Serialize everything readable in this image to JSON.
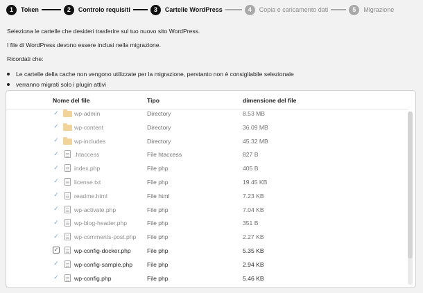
{
  "stepper": {
    "steps": [
      {
        "num": "1",
        "label": "Token",
        "state": "done"
      },
      {
        "num": "2",
        "label": "Controlo requisiti",
        "state": "done"
      },
      {
        "num": "3",
        "label": "Cartelle WordPress",
        "state": "active"
      },
      {
        "num": "4",
        "label": "Copia e caricamento dati",
        "state": "todo"
      },
      {
        "num": "5",
        "label": "Migrazione",
        "state": "todo"
      }
    ]
  },
  "intro": {
    "line1": "Seleziona le cartelle che desideri trasferire sul tuo nuovo sito WordPress.",
    "line2": "I file di WordPress devono essere inclusi nella migrazione.",
    "line3": "Ricordati che:",
    "bullets": [
      "Le cartelle della cache non vengono utilizzate per la migrazione, perstanto non è consigliabile selezionale",
      "verranno migrati solo i plugin attivi"
    ]
  },
  "table": {
    "headers": {
      "name": "Nome del file",
      "type": "Tipo",
      "size": "dimensione del file"
    },
    "rows": [
      {
        "name": "wp-admin",
        "type": "Directory",
        "size": "8.53 MB",
        "icon": "folder-icon",
        "check": "checkmark-icon",
        "state": "dim"
      },
      {
        "name": "wp-content",
        "type": "Directory",
        "size": "36.09 MB",
        "icon": "folder-icon",
        "check": "checkmark-icon",
        "state": "dim"
      },
      {
        "name": "wp-includes",
        "type": "Directory",
        "size": "45.32 MB",
        "icon": "folder-icon",
        "check": "checkmark-icon",
        "state": "dim"
      },
      {
        "name": ".htaccess",
        "type": "File htaccess",
        "size": "827 B",
        "icon": "file-icon",
        "check": "checkmark-icon",
        "state": "dim"
      },
      {
        "name": "index.php",
        "type": "File php",
        "size": "405 B",
        "icon": "file-icon",
        "check": "checkmark-icon",
        "state": "dim"
      },
      {
        "name": "license.txt",
        "type": "File php",
        "size": "19.45 KB",
        "icon": "file-icon",
        "check": "checkmark-icon",
        "state": "dim"
      },
      {
        "name": "readme.html",
        "type": "File html",
        "size": "7.23 KB",
        "icon": "file-icon",
        "check": "checkmark-icon",
        "state": "dim"
      },
      {
        "name": "wp-activate.php",
        "type": "File php",
        "size": "7.04 KB",
        "icon": "file-icon",
        "check": "checkmark-icon",
        "state": "dim"
      },
      {
        "name": "wp-blog-header.php",
        "type": "File php",
        "size": "351 B",
        "icon": "file-icon",
        "check": "checkmark-icon",
        "state": "dim"
      },
      {
        "name": "wp-comments-post.php",
        "type": "File php",
        "size": "2.27 KB",
        "icon": "file-icon",
        "check": "checkmark-icon",
        "state": "dim"
      },
      {
        "name": "wp-config-docker.php",
        "type": "File php",
        "size": "5.35 KB",
        "icon": "file-icon",
        "check": "checkbox-checked-icon",
        "state": "normal"
      },
      {
        "name": "wp-config-sample.php",
        "type": "File php",
        "size": "2.94 KB",
        "icon": "file-icon",
        "check": "checkmark-icon",
        "state": "normal"
      },
      {
        "name": "wp-config.php",
        "type": "File php",
        "size": "5.46 KB",
        "icon": "file-icon",
        "check": "checkmark-icon",
        "state": "normal"
      }
    ]
  }
}
